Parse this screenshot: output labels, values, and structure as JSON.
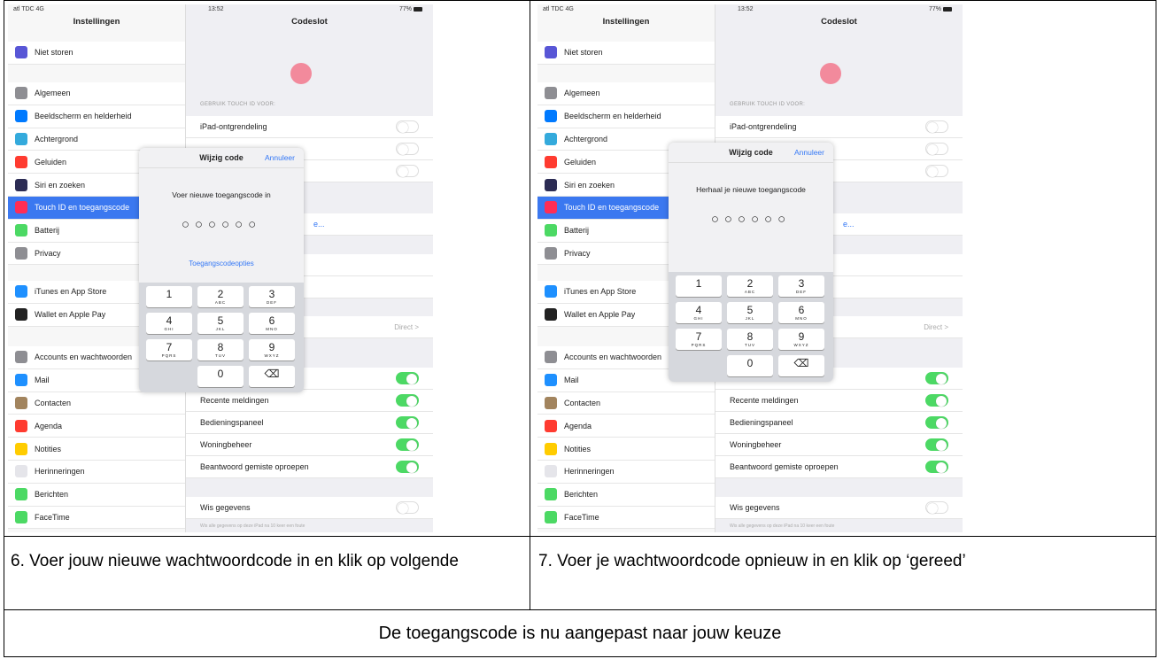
{
  "screens": [
    {
      "status": {
        "carrier": "atl TDC 4G",
        "time": "13:52",
        "battery": "77%"
      },
      "left_title": "Instellingen",
      "right_title": "Codeslot",
      "modal": {
        "title": "Wijzig code",
        "cancel": "Annuleer",
        "prompt": "Voer nieuwe toegangscode in",
        "dots": "○○○○○○",
        "options": "Toegangscodeopties"
      }
    },
    {
      "status": {
        "carrier": "atl TDC 4G",
        "time": "13:52",
        "battery": "77%"
      },
      "left_title": "Instellingen",
      "right_title": "Codeslot",
      "modal": {
        "title": "Wijzig code",
        "cancel": "Annuleer",
        "prompt": "Herhaal je nieuwe toegangscode",
        "dots": "○○○○○○",
        "options": ""
      }
    }
  ],
  "sidebar": {
    "top": [
      {
        "label": "Niet storen",
        "icon": "moon-icon",
        "color": "#5856d6"
      }
    ],
    "group1": [
      {
        "label": "Algemeen",
        "icon": "gear-icon",
        "color": "#8e8e93"
      },
      {
        "label": "Beeldscherm en helderheid",
        "icon": "aa-icon",
        "color": "#007aff"
      },
      {
        "label": "Achtergrond",
        "icon": "flower-icon",
        "color": "#34aadc"
      },
      {
        "label": "Geluiden",
        "icon": "speaker-icon",
        "color": "#ff3b30"
      },
      {
        "label": "Siri en zoeken",
        "icon": "siri-icon",
        "color": "#2c2c54"
      },
      {
        "label": "Touch ID en toegangscode",
        "icon": "fingerprint-icon",
        "color": "#ff2d55"
      },
      {
        "label": "Batterij",
        "icon": "battery-icon",
        "color": "#4cd964"
      },
      {
        "label": "Privacy",
        "icon": "hand-icon",
        "color": "#8e8e93"
      }
    ],
    "group2": [
      {
        "label": "iTunes en App Store",
        "icon": "appstore-icon",
        "color": "#1e90ff"
      },
      {
        "label": "Wallet en Apple Pay",
        "icon": "wallet-icon",
        "color": "#222222"
      }
    ],
    "group3": [
      {
        "label": "Accounts en wachtwoorden",
        "icon": "key-icon",
        "color": "#8e8e93"
      },
      {
        "label": "Mail",
        "icon": "mail-icon",
        "color": "#1e90ff"
      },
      {
        "label": "Contacten",
        "icon": "contacts-icon",
        "color": "#a2845e"
      },
      {
        "label": "Agenda",
        "icon": "calendar-icon",
        "color": "#ff3b30"
      },
      {
        "label": "Notities",
        "icon": "notes-icon",
        "color": "#ffcc00"
      },
      {
        "label": "Herinneringen",
        "icon": "list-icon",
        "color": "#e5e5ea"
      },
      {
        "label": "Berichten",
        "icon": "messages-icon",
        "color": "#4cd964"
      },
      {
        "label": "FaceTime",
        "icon": "facetime-icon",
        "color": "#4cd964"
      }
    ]
  },
  "settings": {
    "section_header": "GEBRUIK TOUCH ID VOOR:",
    "touch_items": [
      {
        "label": "iPad-ontgrendeling",
        "on": false
      },
      {
        "label": "",
        "on": false
      },
      {
        "label": "",
        "on": false
      }
    ],
    "link_partial": "e...",
    "direct_value": "Direct >",
    "locked_items": [
      {
        "label": "",
        "on": true
      },
      {
        "label": "Recente meldingen",
        "on": true
      },
      {
        "label": "Bedieningspaneel",
        "on": true
      },
      {
        "label": "Woningbeheer",
        "on": true
      },
      {
        "label": "Beantwoord gemiste oproepen",
        "on": true
      }
    ],
    "erase_label": "Wis gegevens",
    "erase_note": "Wis alle gegevens op deze iPad na 10 keer een foute"
  },
  "keypad": [
    {
      "num": "1",
      "sub": ""
    },
    {
      "num": "2",
      "sub": "ABC"
    },
    {
      "num": "3",
      "sub": "DEF"
    },
    {
      "num": "4",
      "sub": "GHI"
    },
    {
      "num": "5",
      "sub": "JKL"
    },
    {
      "num": "6",
      "sub": "MNO"
    },
    {
      "num": "7",
      "sub": "PQRS"
    },
    {
      "num": "8",
      "sub": "TUV"
    },
    {
      "num": "9",
      "sub": "WXYZ"
    },
    {
      "num": "",
      "sub": ""
    },
    {
      "num": "0",
      "sub": ""
    },
    {
      "num": "⌫",
      "sub": ""
    }
  ],
  "captions": {
    "step6": "6. Voer jouw nieuwe wachtwoordcode in en klik op volgende",
    "step7": "7. Voer je wachtwoordcode opnieuw in en klik op ‘gereed’",
    "footer": "De toegangscode is nu aangepast naar jouw keuze"
  }
}
